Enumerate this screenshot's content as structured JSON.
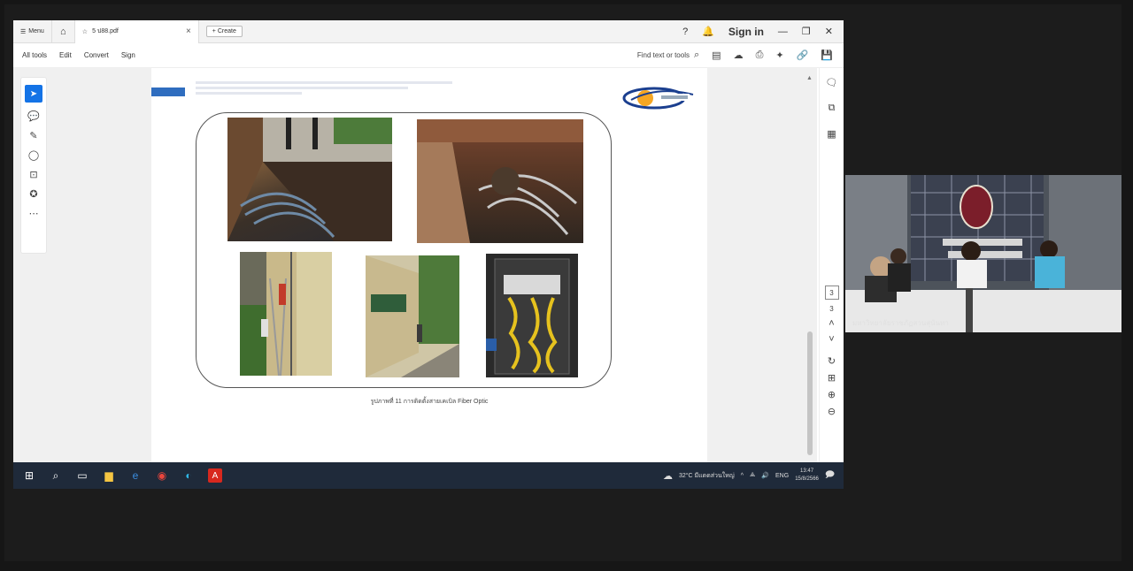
{
  "titlebar": {
    "menu_label": "Menu",
    "tab_title": "5 ป88.pdf",
    "create_label": "+ Create",
    "sign_in": "Sign in"
  },
  "toolbar": {
    "menus": [
      "All tools",
      "Edit",
      "Convert",
      "Sign"
    ],
    "find_placeholder": "Find text or tools"
  },
  "document": {
    "caption": "รูปภาพที่ 11 การติดตั้งสายเคเบิล Fiber Optic"
  },
  "navigation": {
    "current_page": "3",
    "total_pages": "3"
  },
  "taskbar": {
    "weather": "32°C มีแดดส่วนใหญ่",
    "lang": "ENG",
    "time": "13:47",
    "date": "15/8/2566"
  },
  "video": {
    "caption": "มหาวิทยาลัยราชภัฏสวนสุนันทา"
  },
  "colors": {
    "accent": "#1473e6",
    "taskbar": "#1f2a3a"
  }
}
